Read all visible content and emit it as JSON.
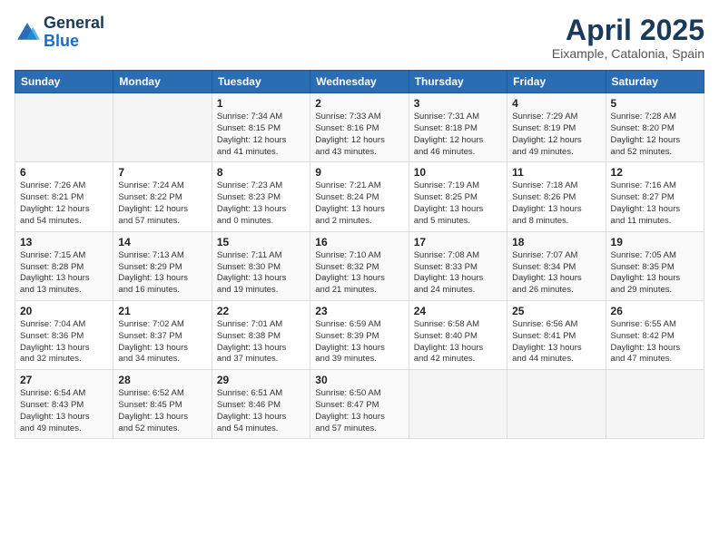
{
  "header": {
    "logo_general": "General",
    "logo_blue": "Blue",
    "title": "April 2025",
    "subtitle": "Eixample, Catalonia, Spain"
  },
  "columns": [
    "Sunday",
    "Monday",
    "Tuesday",
    "Wednesday",
    "Thursday",
    "Friday",
    "Saturday"
  ],
  "weeks": [
    [
      {
        "num": "",
        "info": ""
      },
      {
        "num": "",
        "info": ""
      },
      {
        "num": "1",
        "info": "Sunrise: 7:34 AM\nSunset: 8:15 PM\nDaylight: 12 hours\nand 41 minutes."
      },
      {
        "num": "2",
        "info": "Sunrise: 7:33 AM\nSunset: 8:16 PM\nDaylight: 12 hours\nand 43 minutes."
      },
      {
        "num": "3",
        "info": "Sunrise: 7:31 AM\nSunset: 8:18 PM\nDaylight: 12 hours\nand 46 minutes."
      },
      {
        "num": "4",
        "info": "Sunrise: 7:29 AM\nSunset: 8:19 PM\nDaylight: 12 hours\nand 49 minutes."
      },
      {
        "num": "5",
        "info": "Sunrise: 7:28 AM\nSunset: 8:20 PM\nDaylight: 12 hours\nand 52 minutes."
      }
    ],
    [
      {
        "num": "6",
        "info": "Sunrise: 7:26 AM\nSunset: 8:21 PM\nDaylight: 12 hours\nand 54 minutes."
      },
      {
        "num": "7",
        "info": "Sunrise: 7:24 AM\nSunset: 8:22 PM\nDaylight: 12 hours\nand 57 minutes."
      },
      {
        "num": "8",
        "info": "Sunrise: 7:23 AM\nSunset: 8:23 PM\nDaylight: 13 hours\nand 0 minutes."
      },
      {
        "num": "9",
        "info": "Sunrise: 7:21 AM\nSunset: 8:24 PM\nDaylight: 13 hours\nand 2 minutes."
      },
      {
        "num": "10",
        "info": "Sunrise: 7:19 AM\nSunset: 8:25 PM\nDaylight: 13 hours\nand 5 minutes."
      },
      {
        "num": "11",
        "info": "Sunrise: 7:18 AM\nSunset: 8:26 PM\nDaylight: 13 hours\nand 8 minutes."
      },
      {
        "num": "12",
        "info": "Sunrise: 7:16 AM\nSunset: 8:27 PM\nDaylight: 13 hours\nand 11 minutes."
      }
    ],
    [
      {
        "num": "13",
        "info": "Sunrise: 7:15 AM\nSunset: 8:28 PM\nDaylight: 13 hours\nand 13 minutes."
      },
      {
        "num": "14",
        "info": "Sunrise: 7:13 AM\nSunset: 8:29 PM\nDaylight: 13 hours\nand 16 minutes."
      },
      {
        "num": "15",
        "info": "Sunrise: 7:11 AM\nSunset: 8:30 PM\nDaylight: 13 hours\nand 19 minutes."
      },
      {
        "num": "16",
        "info": "Sunrise: 7:10 AM\nSunset: 8:32 PM\nDaylight: 13 hours\nand 21 minutes."
      },
      {
        "num": "17",
        "info": "Sunrise: 7:08 AM\nSunset: 8:33 PM\nDaylight: 13 hours\nand 24 minutes."
      },
      {
        "num": "18",
        "info": "Sunrise: 7:07 AM\nSunset: 8:34 PM\nDaylight: 13 hours\nand 26 minutes."
      },
      {
        "num": "19",
        "info": "Sunrise: 7:05 AM\nSunset: 8:35 PM\nDaylight: 13 hours\nand 29 minutes."
      }
    ],
    [
      {
        "num": "20",
        "info": "Sunrise: 7:04 AM\nSunset: 8:36 PM\nDaylight: 13 hours\nand 32 minutes."
      },
      {
        "num": "21",
        "info": "Sunrise: 7:02 AM\nSunset: 8:37 PM\nDaylight: 13 hours\nand 34 minutes."
      },
      {
        "num": "22",
        "info": "Sunrise: 7:01 AM\nSunset: 8:38 PM\nDaylight: 13 hours\nand 37 minutes."
      },
      {
        "num": "23",
        "info": "Sunrise: 6:59 AM\nSunset: 8:39 PM\nDaylight: 13 hours\nand 39 minutes."
      },
      {
        "num": "24",
        "info": "Sunrise: 6:58 AM\nSunset: 8:40 PM\nDaylight: 13 hours\nand 42 minutes."
      },
      {
        "num": "25",
        "info": "Sunrise: 6:56 AM\nSunset: 8:41 PM\nDaylight: 13 hours\nand 44 minutes."
      },
      {
        "num": "26",
        "info": "Sunrise: 6:55 AM\nSunset: 8:42 PM\nDaylight: 13 hours\nand 47 minutes."
      }
    ],
    [
      {
        "num": "27",
        "info": "Sunrise: 6:54 AM\nSunset: 8:43 PM\nDaylight: 13 hours\nand 49 minutes."
      },
      {
        "num": "28",
        "info": "Sunrise: 6:52 AM\nSunset: 8:45 PM\nDaylight: 13 hours\nand 52 minutes."
      },
      {
        "num": "29",
        "info": "Sunrise: 6:51 AM\nSunset: 8:46 PM\nDaylight: 13 hours\nand 54 minutes."
      },
      {
        "num": "30",
        "info": "Sunrise: 6:50 AM\nSunset: 8:47 PM\nDaylight: 13 hours\nand 57 minutes."
      },
      {
        "num": "",
        "info": ""
      },
      {
        "num": "",
        "info": ""
      },
      {
        "num": "",
        "info": ""
      }
    ]
  ]
}
